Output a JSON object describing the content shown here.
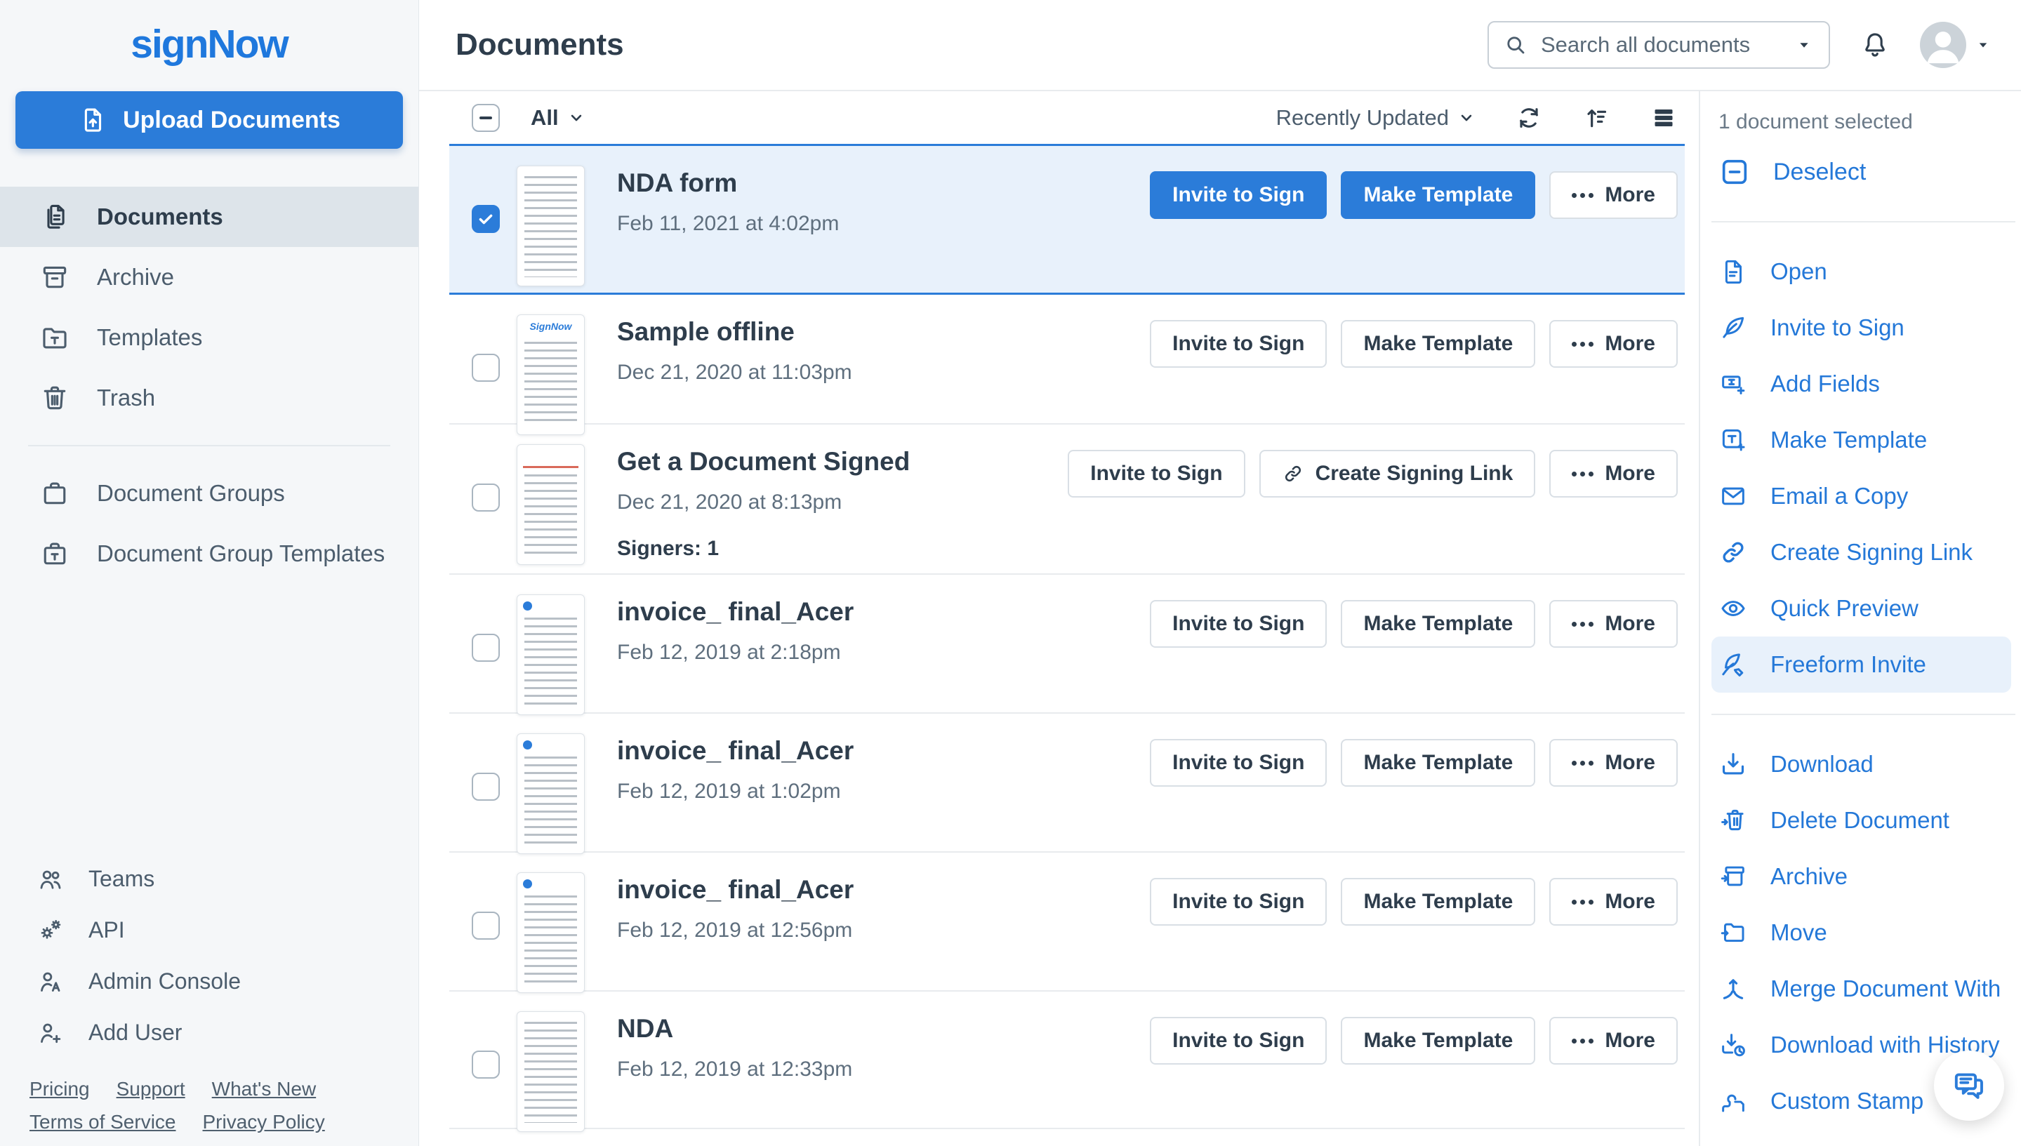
{
  "colors": {
    "accent_blue": "#2b7cd9",
    "link_blue": "#2478d8",
    "selected_row_bg": "#e8f1fb",
    "sidebar_bg": "#f5f7f9",
    "active_nav_bg": "#dde4ea",
    "text_dark": "#2e3d4c",
    "text_gray": "#5f6f7e"
  },
  "sidebar": {
    "logo": "signNow",
    "upload_label": "Upload Documents",
    "nav": [
      {
        "icon": "documents-icon",
        "label": "Documents",
        "active": true
      },
      {
        "icon": "archive-icon",
        "label": "Archive",
        "active": false
      },
      {
        "icon": "templates-icon",
        "label": "Templates",
        "active": false
      },
      {
        "icon": "trash-icon",
        "label": "Trash",
        "active": false
      },
      {
        "icon": "document-groups-icon",
        "label": "Document Groups",
        "active": false
      },
      {
        "icon": "document-group-templates-icon",
        "label": "Document Group Templates",
        "active": false
      }
    ],
    "nav_bottom": [
      {
        "icon": "teams-icon",
        "label": "Teams"
      },
      {
        "icon": "api-gears-icon",
        "label": "API"
      },
      {
        "icon": "admin-console-icon",
        "label": "Admin Console"
      },
      {
        "icon": "add-user-icon",
        "label": "Add User"
      }
    ],
    "footer_links": [
      {
        "label": "Pricing"
      },
      {
        "label": "Support"
      },
      {
        "label": "What's New"
      },
      {
        "label": "Terms of Service"
      },
      {
        "label": "Privacy Policy"
      }
    ]
  },
  "header": {
    "title": "Documents",
    "search_placeholder": "Search all documents"
  },
  "toolbar": {
    "filter_label": "All",
    "sort_label": "Recently Updated"
  },
  "rows": [
    {
      "title": "NDA form",
      "date": "Feb 11, 2021 at 4:02pm",
      "selected": true,
      "buttons": [
        {
          "label": "Invite to Sign"
        },
        {
          "label": "Make Template"
        },
        {
          "label": "More"
        }
      ]
    },
    {
      "title": "Sample offline",
      "date": "Dec 21, 2020 at 11:03pm",
      "selected": false,
      "buttons": [
        {
          "label": "Invite to Sign"
        },
        {
          "label": "Make Template"
        },
        {
          "label": "More"
        }
      ]
    },
    {
      "title": "Get a Document Signed",
      "date": "Dec 21, 2020 at 8:13pm",
      "selected": false,
      "signers": "Signers: 1",
      "buttons": [
        {
          "label": "Invite to Sign"
        },
        {
          "label": "Create Signing Link"
        },
        {
          "label": "More"
        }
      ]
    },
    {
      "title": "invoice_ final_Acer",
      "date": "Feb 12, 2019 at 2:18pm",
      "selected": false,
      "buttons": [
        {
          "label": "Invite to Sign"
        },
        {
          "label": "Make Template"
        },
        {
          "label": "More"
        }
      ]
    },
    {
      "title": "invoice_ final_Acer",
      "date": "Feb 12, 2019 at 1:02pm",
      "selected": false,
      "buttons": [
        {
          "label": "Invite to Sign"
        },
        {
          "label": "Make Template"
        },
        {
          "label": "More"
        }
      ]
    },
    {
      "title": "invoice_ final_Acer",
      "date": "Feb 12, 2019 at 12:56pm",
      "selected": false,
      "buttons": [
        {
          "label": "Invite to Sign"
        },
        {
          "label": "Make Template"
        },
        {
          "label": "More"
        }
      ]
    },
    {
      "title": "NDA",
      "date": "Feb 12, 2019 at 12:33pm",
      "selected": false,
      "buttons": [
        {
          "label": "Invite to Sign"
        },
        {
          "label": "Make Template"
        },
        {
          "label": "More"
        }
      ]
    }
  ],
  "action_panel": {
    "selected_count": "1 document selected",
    "deselect_label": "Deselect",
    "actions_primary": [
      {
        "icon": "open-document-icon",
        "label": "Open"
      },
      {
        "icon": "quill-icon",
        "label": "Invite to Sign"
      },
      {
        "icon": "add-fields-icon",
        "label": "Add Fields"
      },
      {
        "icon": "make-template-icon",
        "label": "Make Template"
      },
      {
        "icon": "envelope-icon",
        "label": "Email a Copy"
      },
      {
        "icon": "link-icon",
        "label": "Create Signing Link"
      },
      {
        "icon": "eye-icon",
        "label": "Quick Preview"
      },
      {
        "icon": "freeform-quill-pencil-icon",
        "label": "Freeform Invite",
        "highlighted": true
      }
    ],
    "actions_secondary": [
      {
        "icon": "download-icon",
        "label": "Download"
      },
      {
        "icon": "delete-document-icon",
        "label": "Delete Document"
      },
      {
        "icon": "archive-move-icon",
        "label": "Archive"
      },
      {
        "icon": "move-folder-icon",
        "label": "Move"
      },
      {
        "icon": "merge-icon",
        "label": "Merge Document With"
      },
      {
        "icon": "download-with-history-icon",
        "label": "Download with History"
      },
      {
        "icon": "stamp-icon",
        "label": "Custom Stamp"
      }
    ]
  }
}
